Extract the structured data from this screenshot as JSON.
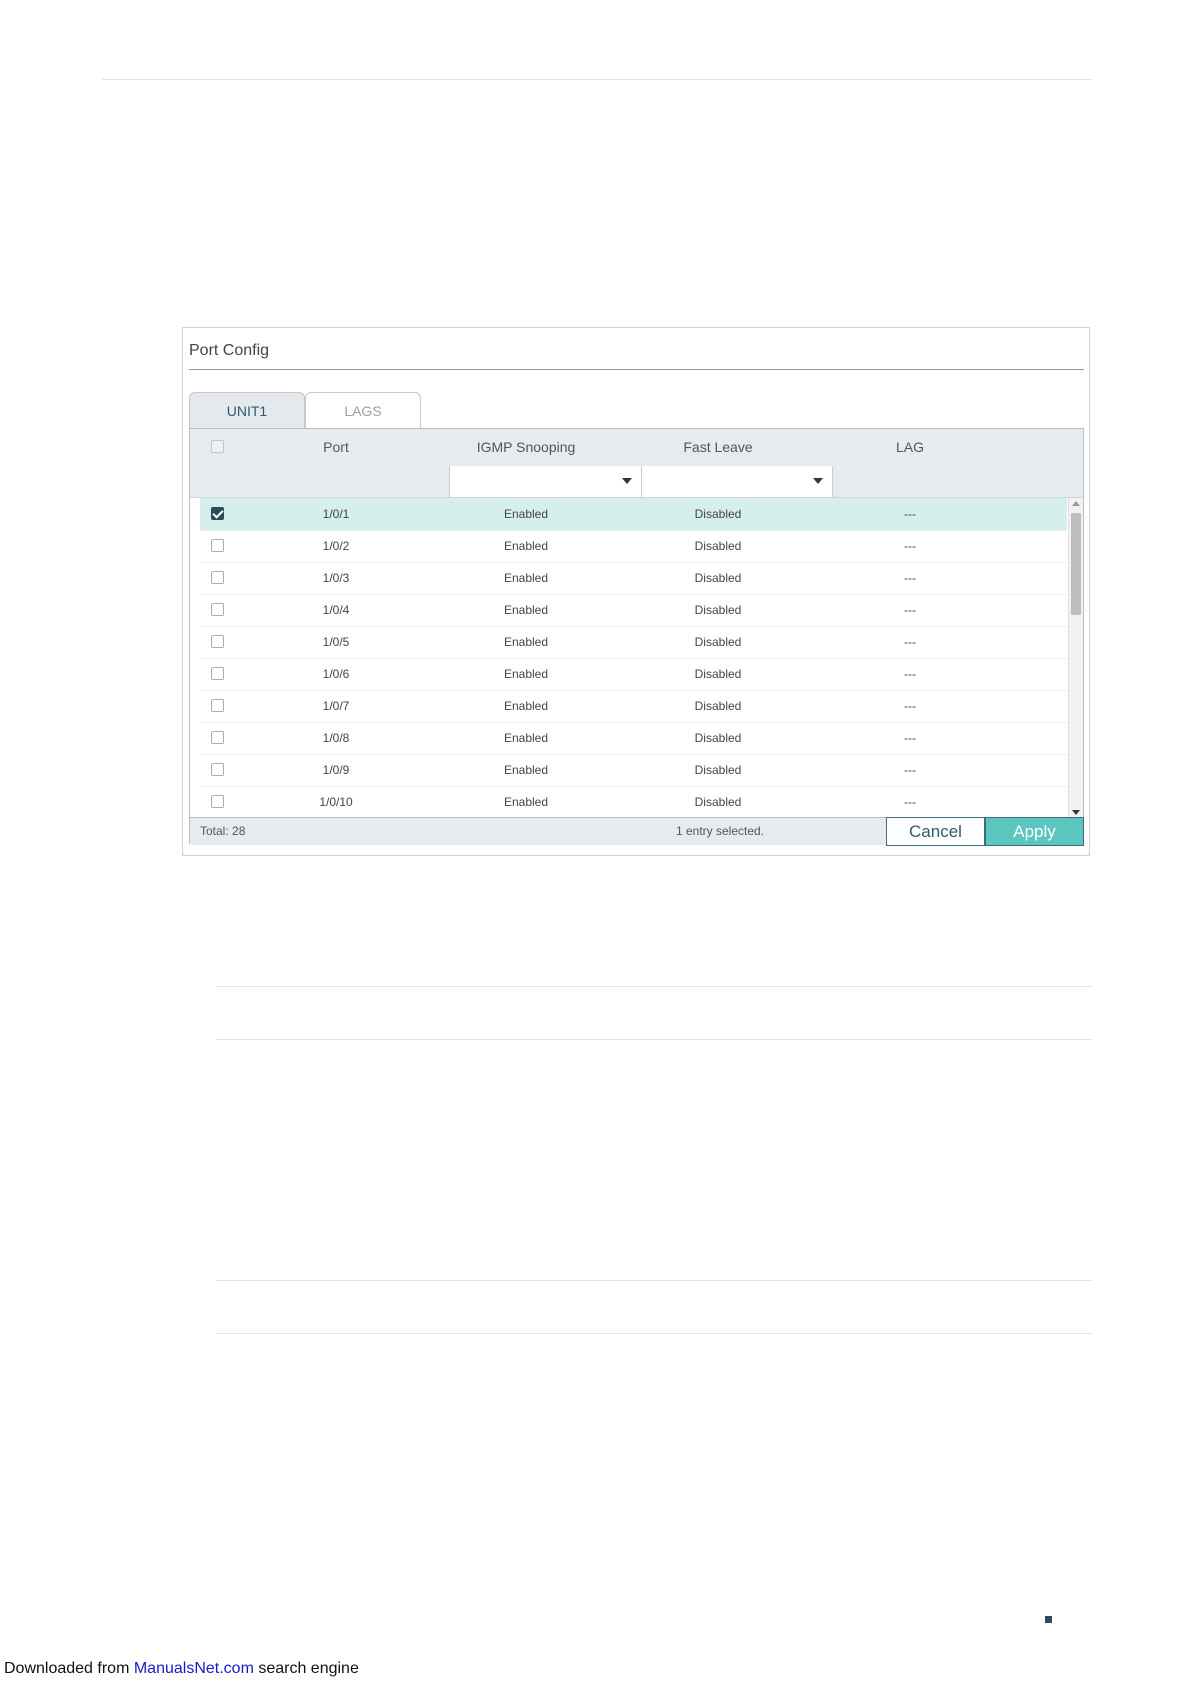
{
  "panel": {
    "title": "Port Config",
    "tabs": [
      {
        "label": "UNIT1",
        "active": true
      },
      {
        "label": "LAGS",
        "active": false
      }
    ],
    "columns": [
      "Port",
      "IGMP Snooping",
      "Fast Leave",
      "LAG"
    ],
    "rows": [
      {
        "port": "1/0/1",
        "igmp": "Enabled",
        "fast_leave": "Disabled",
        "lag": "---",
        "checked": true
      },
      {
        "port": "1/0/2",
        "igmp": "Enabled",
        "fast_leave": "Disabled",
        "lag": "---",
        "checked": false
      },
      {
        "port": "1/0/3",
        "igmp": "Enabled",
        "fast_leave": "Disabled",
        "lag": "---",
        "checked": false
      },
      {
        "port": "1/0/4",
        "igmp": "Enabled",
        "fast_leave": "Disabled",
        "lag": "---",
        "checked": false
      },
      {
        "port": "1/0/5",
        "igmp": "Enabled",
        "fast_leave": "Disabled",
        "lag": "---",
        "checked": false
      },
      {
        "port": "1/0/6",
        "igmp": "Enabled",
        "fast_leave": "Disabled",
        "lag": "---",
        "checked": false
      },
      {
        "port": "1/0/7",
        "igmp": "Enabled",
        "fast_leave": "Disabled",
        "lag": "---",
        "checked": false
      },
      {
        "port": "1/0/8",
        "igmp": "Enabled",
        "fast_leave": "Disabled",
        "lag": "---",
        "checked": false
      },
      {
        "port": "1/0/9",
        "igmp": "Enabled",
        "fast_leave": "Disabled",
        "lag": "---",
        "checked": false
      },
      {
        "port": "1/0/10",
        "igmp": "Enabled",
        "fast_leave": "Disabled",
        "lag": "---",
        "checked": false
      }
    ],
    "footer": {
      "total": "Total: 28",
      "selected": "1 entry selected.",
      "cancel_label": "Cancel",
      "apply_label": "Apply"
    }
  },
  "download": {
    "prefix": "Downloaded from ",
    "link": "ManualsNet.com",
    "suffix": " search engine"
  },
  "colors": {
    "selected_row": "#d4efec",
    "apply_button": "#5bc5bf",
    "header_bg": "#e6ebee",
    "link": "#1a1acc"
  }
}
